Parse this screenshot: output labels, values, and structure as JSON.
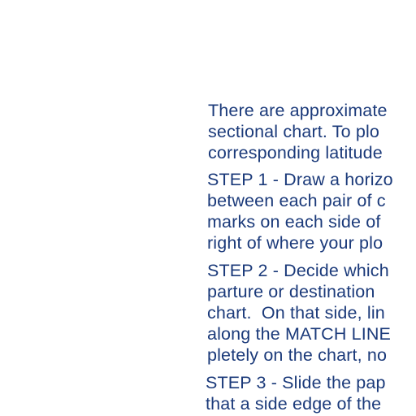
{
  "document": {
    "paragraphs": [
      {
        "lines": [
          "There are approximate",
          "sectional chart. To plo",
          "corresponding latitude"
        ]
      },
      {
        "lines": [
          "STEP 1 - Draw a horizo",
          "between each pair of c",
          "marks on each side of",
          "right of where your plo"
        ]
      },
      {
        "lines": [
          "STEP 2 - Decide which",
          "parture or destination",
          "chart.  On that side, lin",
          "along the MATCH LINE",
          "pletely on the chart, no"
        ]
      },
      {
        "lines": [
          "STEP 3 - Slide the pap",
          "that a side edge of the"
        ]
      }
    ]
  },
  "colors": {
    "text": "#1b3a7a",
    "background": "#ffffff"
  }
}
